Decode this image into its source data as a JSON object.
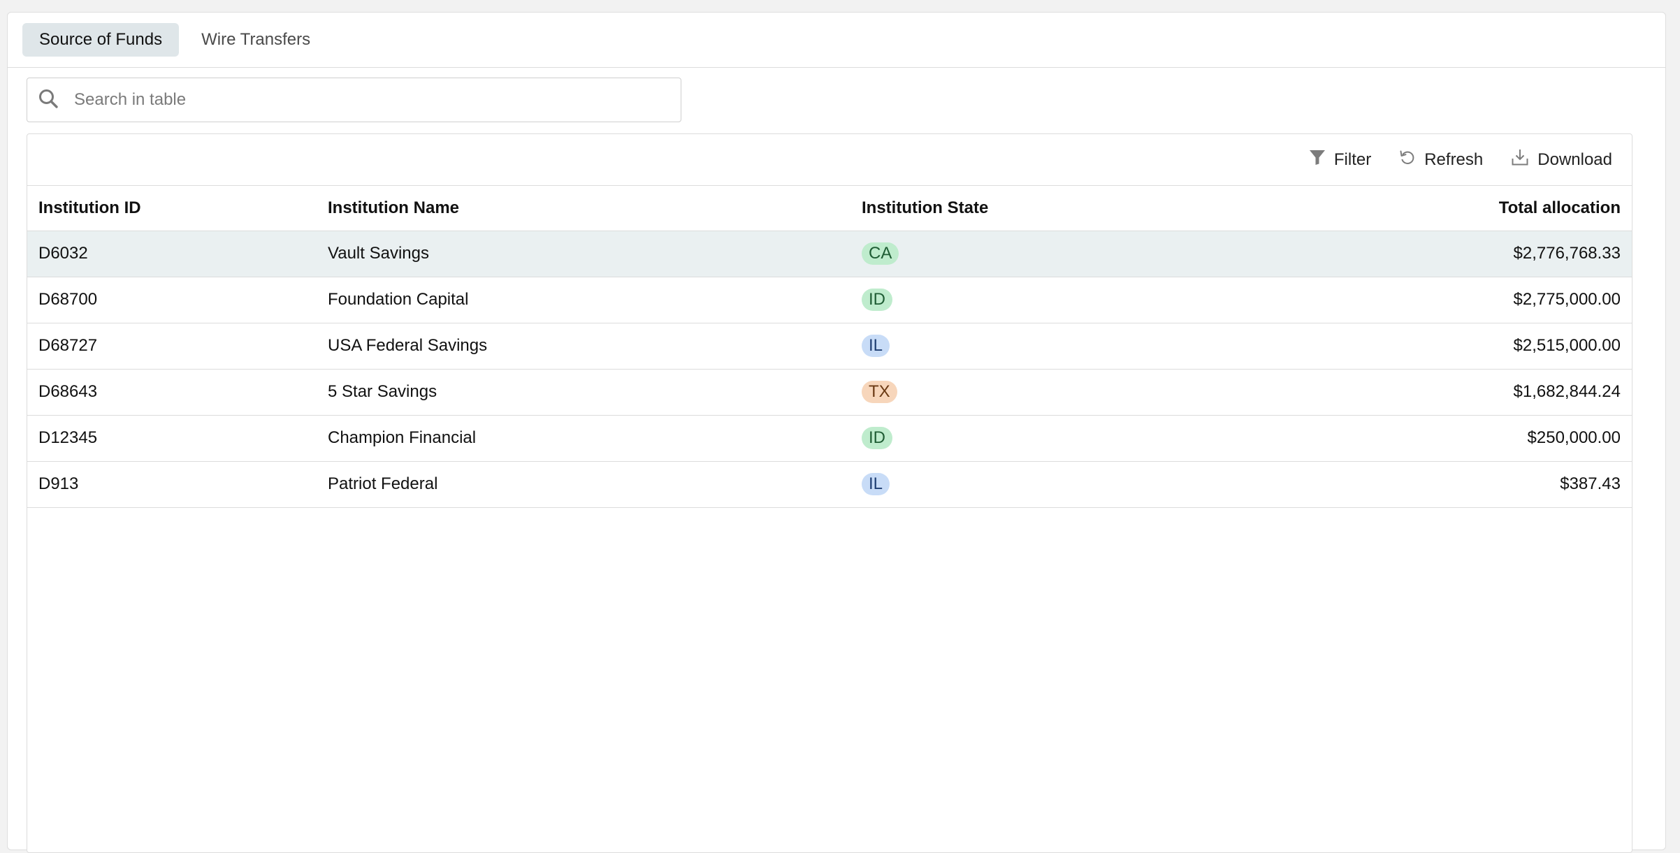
{
  "tabs": [
    {
      "label": "Source of Funds",
      "active": true
    },
    {
      "label": "Wire Transfers",
      "active": false
    }
  ],
  "search": {
    "placeholder": "Search in table",
    "value": ""
  },
  "toolbar": {
    "filter_label": "Filter",
    "refresh_label": "Refresh",
    "download_label": "Download"
  },
  "table": {
    "columns": [
      "Institution ID",
      "Institution Name",
      "Institution State",
      "Total allocation"
    ],
    "rows": [
      {
        "id": "D6032",
        "name": "Vault Savings",
        "state": "CA",
        "allocation": "$2,776,768.33",
        "selected": true
      },
      {
        "id": "D68700",
        "name": "Foundation Capital",
        "state": "ID",
        "allocation": "$2,775,000.00",
        "selected": false
      },
      {
        "id": "D68727",
        "name": "USA Federal Savings",
        "state": "IL",
        "allocation": "$2,515,000.00",
        "selected": false
      },
      {
        "id": "D68643",
        "name": "5 Star Savings",
        "state": "TX",
        "allocation": "$1,682,844.24",
        "selected": false
      },
      {
        "id": "D12345",
        "name": "Champion Financial",
        "state": "ID",
        "allocation": "$250,000.00",
        "selected": false
      },
      {
        "id": "D913",
        "name": "Patriot Federal",
        "state": "IL",
        "allocation": "$387.43",
        "selected": false
      }
    ]
  },
  "state_colors": {
    "CA": {
      "bg": "#bfeccd",
      "fg": "#1f5d34"
    },
    "ID": {
      "bg": "#bfeccd",
      "fg": "#1f5d34"
    },
    "IL": {
      "bg": "#c8dcf7",
      "fg": "#1f3f73"
    },
    "TX": {
      "bg": "#f7d6bb",
      "fg": "#6b3a14"
    }
  },
  "icons": {
    "search": "search-icon",
    "filter": "filter-icon",
    "refresh": "refresh-icon",
    "download": "download-icon"
  }
}
